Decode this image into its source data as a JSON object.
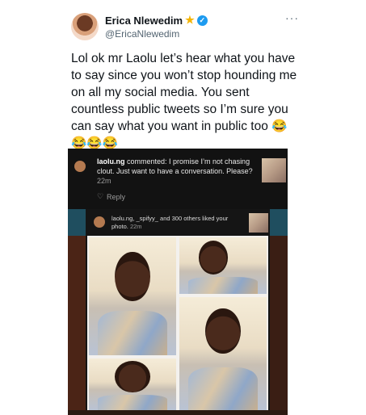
{
  "author": {
    "name": "Erica Nlewedim",
    "name_emoji": "★",
    "verified_glyph": "✓",
    "handle": "@EricaNlewedim"
  },
  "more_icon": "···",
  "tweet_text": "Lol ok mr Laolu let’s hear what you have to say since you won’t stop hounding me on all my social media. You sent countless public tweets so I’m sure you can say what you want in public too 😂😂😂😂",
  "media": {
    "comment": {
      "username": "laolu.ng",
      "verb": " commented: ",
      "body": "I promise I’m not chasing clout. Just want to have a conversation. Please?",
      "time": " 22m",
      "heart_icon": "♡",
      "reply_label": "Reply"
    },
    "likes": {
      "text": "laolu.ng, _spifyy_ and 300 others liked your photo.",
      "time": " 22m"
    }
  },
  "colors": {
    "verified": "#1d9bf0",
    "star": "#f4b400",
    "handle": "#536471",
    "media_dark": "#121212",
    "teal_strip": "#1f4e5f"
  }
}
